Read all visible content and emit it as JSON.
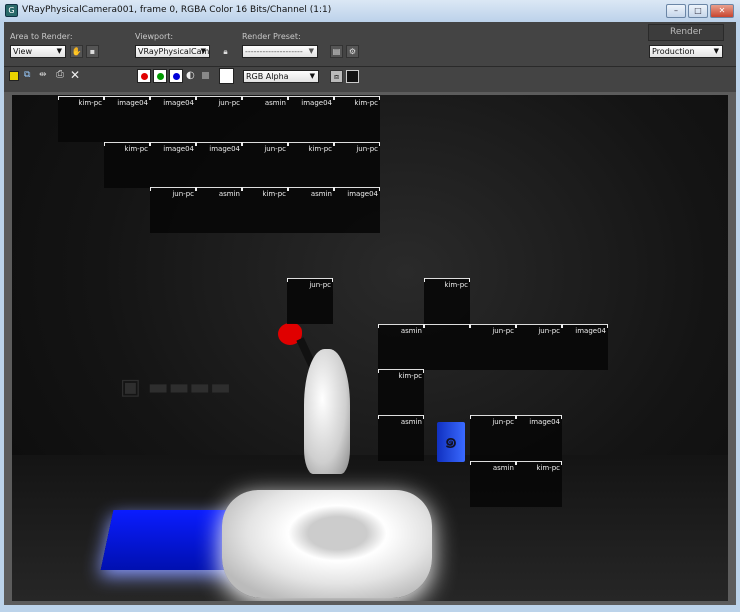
{
  "window": {
    "title": "VRayPhysicalCamera001, frame 0, RGBA Color 16 Bits/Channel (1:1)",
    "minimize": "–",
    "maximize": "□",
    "close": "✕"
  },
  "toolbar": {
    "area_label": "Area to Render:",
    "area_value": "View",
    "viewport_label": "Viewport:",
    "viewport_value": "VRayPhysicalCam",
    "preset_label": "Render Preset:",
    "preset_value": "--------------------",
    "render_label": "Render",
    "mode_value": "Production",
    "channel_value": "RGB Alpha",
    "channel_colors": {
      "red": "#e00000",
      "green": "#009a00",
      "blue": "#0000d8"
    }
  },
  "icons": [
    "save-image-icon",
    "copy-image-icon",
    "clone-window-icon",
    "print-icon",
    "clear-icon",
    "mono-icon",
    "alpha-icon",
    "toggle-ui-overlay-icon",
    "toggle-ui-icon"
  ],
  "buckets": [
    [
      "kim-pc",
      "image04",
      "image04",
      "jun-pc",
      "asmin",
      "image04",
      "kim-pc"
    ],
    [
      "kim-pc",
      "image04",
      "image04",
      "jun-pc",
      "kim-pc",
      "jun-pc"
    ],
    [
      "jun-pc",
      "asmin",
      "kim-pc",
      "asmin",
      "image04"
    ],
    [
      "jun-pc",
      "kim-pc"
    ],
    [
      "asmin",
      "",
      "jun-pc",
      "jun-pc",
      "image04"
    ],
    [
      "kim-pc"
    ],
    [
      "asmin",
      "jun-pc",
      "image04"
    ],
    [
      "asmin",
      "kim-pc"
    ]
  ]
}
